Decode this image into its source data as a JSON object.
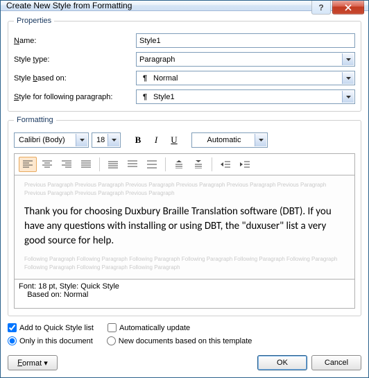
{
  "title": "Create New Style from Formatting",
  "properties": {
    "legend": "Properties",
    "name_label_pre": "",
    "name_label_u": "N",
    "name_label_post": "ame:",
    "name_value": "Style1",
    "type_label_pre": "Style ",
    "type_label_u": "t",
    "type_label_post": "ype:",
    "type_value": "Paragraph",
    "based_label_pre": "Style ",
    "based_label_u": "b",
    "based_label_post": "ased on:",
    "based_value": "Normal",
    "following_label_pre": "Style for following paragraph:",
    "following_value": "Style1"
  },
  "formatting": {
    "legend": "Formatting",
    "font_name": "Calibri (Body)",
    "font_size": "18",
    "bold_label": "B",
    "italic_label": "I",
    "underline_label": "U",
    "color_label": "Automatic",
    "ghost_prev": "Previous Paragraph Previous Paragraph Previous Paragraph Previous Paragraph Previous Paragraph Previous Paragraph Previous Paragraph Previous Paragraph Previous Paragraph",
    "sample_text": "Thank you for choosing Duxbury Braille Translation software (DBT).  If you have any questions with installing or using DBT, the \"duxuser\" list a very good source for help.",
    "ghost_next": "Following Paragraph Following Paragraph Following Paragraph Following Paragraph Following Paragraph Following Paragraph Following Paragraph Following Paragraph Following Paragraph"
  },
  "description": {
    "line1": "Font: 18 pt, Style: Quick Style",
    "line2": "    Based on: Normal"
  },
  "options": {
    "add_quick": "Add to Quick Style list",
    "auto_update": "Automatically update",
    "only_doc": "Only in this document",
    "new_docs": "New documents based on this template"
  },
  "buttons": {
    "format": "Format ▾",
    "ok": "OK",
    "cancel": "Cancel"
  }
}
